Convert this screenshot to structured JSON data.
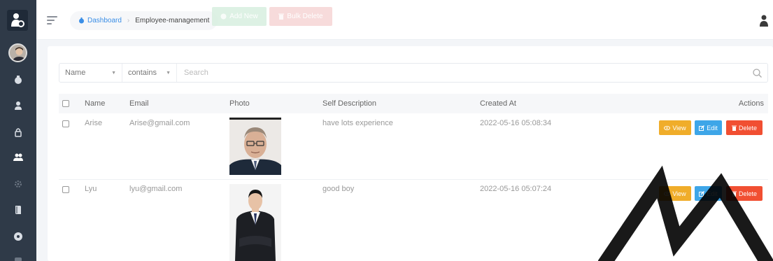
{
  "sidebar": {
    "icons": [
      "logo-icon",
      "avatar",
      "home-icon",
      "user-icon",
      "lock-icon",
      "users-icon",
      "gear-icon",
      "book-icon",
      "disc-icon"
    ]
  },
  "topbar": {
    "breadcrumb": {
      "home": "Dashboard",
      "current": "Employee-management"
    },
    "add_label": "Add New",
    "bulk_delete_label": "Bulk Delete"
  },
  "filter": {
    "field": "Name",
    "operator": "contains",
    "placeholder": "Search"
  },
  "table": {
    "columns": [
      "Name",
      "Email",
      "Photo",
      "Self Description",
      "Created At",
      "Actions"
    ],
    "rows": [
      {
        "name": "Arise",
        "email": "Arise@gmail.com",
        "description": "have lots experience",
        "created_at": "2022-05-16 05:08:34"
      },
      {
        "name": "Lyu",
        "email": "lyu@gmail.com",
        "description": "good boy",
        "created_at": "2022-05-16 05:07:24"
      }
    ],
    "actions": {
      "view": "View",
      "edit": "Edit",
      "delete": "Delete"
    }
  },
  "colors": {
    "sidebar": "#2f3a48",
    "accent": "#3a8ee6",
    "view": "#f0ad2a",
    "edit": "#3ea6e8",
    "delete": "#f14f32"
  }
}
